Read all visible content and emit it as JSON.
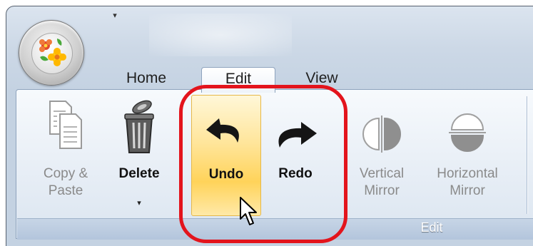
{
  "qat": {
    "dropdown_glyph": "▾"
  },
  "tabs": [
    {
      "label": "Home",
      "active": false
    },
    {
      "label": "Edit",
      "active": true
    },
    {
      "label": "View",
      "active": false
    }
  ],
  "ribbon": {
    "buttons": {
      "copy_paste": {
        "line1": "Copy &",
        "line2": "Paste",
        "enabled": false,
        "icon": "copy-paste-icon"
      },
      "delete": {
        "label": "Delete",
        "caret": "▾",
        "enabled": true,
        "icon": "trash-can-icon"
      },
      "undo": {
        "label": "Undo",
        "enabled": true,
        "hovered": true,
        "icon": "undo-arrow-icon"
      },
      "redo": {
        "label": "Redo",
        "enabled": true,
        "icon": "redo-arrow-icon"
      },
      "vertical_mirror": {
        "line1": "Vertical",
        "line2": "Mirror",
        "enabled": false,
        "icon": "vertical-mirror-icon"
      },
      "horizontal_mirror": {
        "line1": "Horizontal",
        "line2": "Mirror",
        "enabled": false,
        "icon": "horizontal-mirror-icon"
      }
    },
    "group_label": "Edit"
  },
  "colors": {
    "highlight_ring": "#e3141c",
    "hover_fill": "#ffd35a",
    "disabled_text": "#8a8a8a"
  }
}
